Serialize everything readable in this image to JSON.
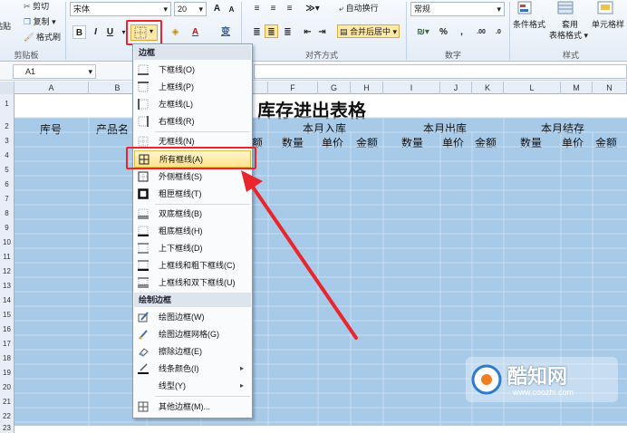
{
  "ribbon": {
    "clipboard": {
      "cut": "剪切",
      "copy": "复制",
      "paste_partial": "粘贴",
      "format_painter": "格式刷",
      "group_label": "剪贴板"
    },
    "font": {
      "name": "宋体",
      "size": "20",
      "grow": "A",
      "shrink": "A",
      "bold": "B",
      "italic": "I",
      "underline": "U",
      "font_color": "A",
      "phonetic": "变"
    },
    "alignment": {
      "wrap": "自动换行",
      "merge": "合并后居中",
      "group_label": "对齐方式"
    },
    "number": {
      "format": "常规",
      "percent": "%",
      "comma": ",",
      "inc_decimal": ".00",
      "dec_decimal": ".0",
      "group_label": "数字"
    },
    "styles": {
      "conditional": "条件格式",
      "table_line1": "套用",
      "table_line2": "表格格式",
      "cell_partial": "单元格样",
      "group_label": "样式"
    }
  },
  "formula_bar": {
    "name_box": "A1"
  },
  "columns": [
    "A",
    "B",
    "C",
    "D",
    "E",
    "F",
    "G",
    "H",
    "I",
    "J",
    "K",
    "L",
    "M",
    "N"
  ],
  "rows": [
    "1",
    "2",
    "3",
    "4",
    "5",
    "6",
    "7",
    "8",
    "9",
    "10",
    "11",
    "12",
    "13",
    "14",
    "15",
    "16",
    "17",
    "18",
    "19",
    "20",
    "21",
    "22",
    "23"
  ],
  "sheet": {
    "title": "库存进出表格",
    "col_a": "库号",
    "col_b_partial": "产品名",
    "col_d_partial": "额",
    "groups": [
      "本月入库",
      "本月出库",
      "本月结存"
    ],
    "sub": [
      "数量",
      "单价",
      "金额",
      "数量",
      "单价",
      "金额",
      "数量",
      "单价",
      "金额"
    ]
  },
  "menu": {
    "header_border": "边框",
    "items": [
      {
        "label": "下框线(O)",
        "icon": "bottom-border-icon"
      },
      {
        "label": "上框线(P)",
        "icon": "top-border-icon"
      },
      {
        "label": "左框线(L)",
        "icon": "left-border-icon"
      },
      {
        "label": "右框线(R)",
        "icon": "right-border-icon"
      },
      {
        "label": "无框线(N)",
        "icon": "no-border-icon"
      },
      {
        "label": "所有框线(A)",
        "icon": "all-borders-icon"
      },
      {
        "label": "外侧框线(S)",
        "icon": "outside-borders-icon"
      },
      {
        "label": "粗匣框线(T)",
        "icon": "thick-box-border-icon"
      },
      {
        "label": "双底框线(B)",
        "icon": "double-bottom-border-icon"
      },
      {
        "label": "粗底框线(H)",
        "icon": "thick-bottom-border-icon"
      },
      {
        "label": "上下框线(D)",
        "icon": "top-bottom-border-icon"
      },
      {
        "label": "上框线和粗下框线(C)",
        "icon": "top-thick-bottom-border-icon"
      },
      {
        "label": "上框线和双下框线(U)",
        "icon": "top-double-bottom-border-icon"
      }
    ],
    "header_draw": "绘制边框",
    "draw_items": [
      {
        "label": "绘图边框(W)",
        "icon": "draw-border-icon"
      },
      {
        "label": "绘图边框网格(G)",
        "icon": "draw-border-grid-icon"
      },
      {
        "label": "擦除边框(E)",
        "icon": "eraser-icon"
      },
      {
        "label": "线条颜色(I)",
        "icon": "line-color-icon",
        "submenu": true
      },
      {
        "label": "线型(Y)",
        "icon": "line-style-icon",
        "submenu": true
      },
      {
        "label": "其他边框(M)...",
        "icon": "more-borders-icon"
      }
    ]
  },
  "watermark": {
    "brand": "酷知网",
    "url": "www.coozhi.com"
  },
  "colors": {
    "sheet_fill": "#a8cae9",
    "highlight": "#e8262b",
    "menu_hover": "#ffe28a"
  }
}
